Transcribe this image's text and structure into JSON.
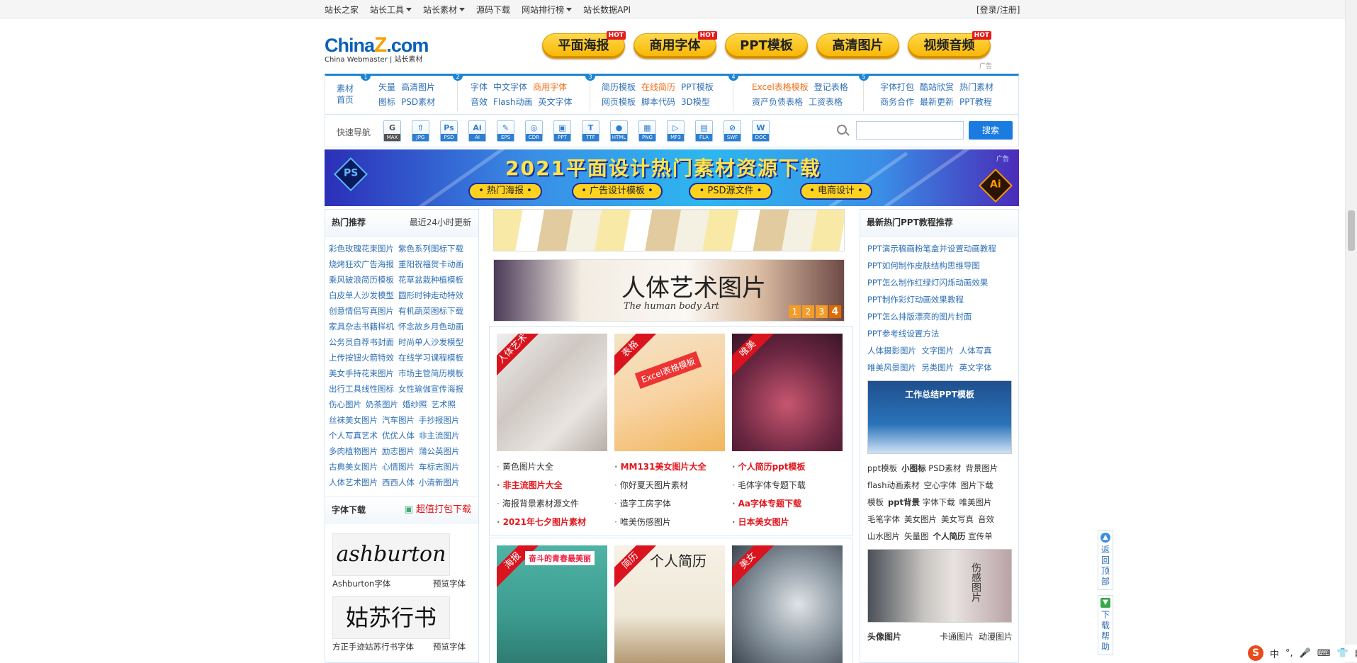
{
  "topnav": {
    "items": [
      "站长之家",
      "站长工具",
      "站长素材",
      "源码下载",
      "网站排行榜",
      "站长数据API"
    ],
    "login": "[登录/注册]"
  },
  "logo": {
    "main": "China",
    "z": "Z",
    "com": ".com",
    "sub": "China Webmaster | 站长素材"
  },
  "bigbuttons": [
    {
      "label": "平面海报",
      "hot": "HOT"
    },
    {
      "label": "商用字体",
      "hot": "HOT"
    },
    {
      "label": "PPT模板",
      "hot": ""
    },
    {
      "label": "高清图片",
      "hot": ""
    },
    {
      "label": "视频音频",
      "hot": "HOT"
    }
  ],
  "ad_label": "广告",
  "menu": {
    "home": [
      "素材",
      "首页"
    ],
    "col1": [
      [
        "矢量",
        "高清图片"
      ],
      [
        "图标",
        "PSD素材"
      ]
    ],
    "col2": [
      [
        "字体",
        "中文字体",
        "商用字体"
      ],
      [
        "音效",
        "Flash动画",
        "英文字体"
      ]
    ],
    "col3": [
      [
        "简历模板",
        "在线简历",
        "PPT模板"
      ],
      [
        "网页模板",
        "脚本代码",
        "3D模型"
      ]
    ],
    "col4": [
      [
        "Excel表格模板",
        "登记表格"
      ],
      [
        "资产负债表格",
        "工资表格"
      ]
    ],
    "col5": [
      [
        "字体打包",
        "酷站欣赏",
        "热门素材"
      ],
      [
        "商务合作",
        "最新更新",
        "PPT教程"
      ]
    ],
    "nums": [
      "1",
      "2",
      "3",
      "4",
      "5"
    ]
  },
  "quick": {
    "label": "快速导航",
    "icons": [
      "MAX",
      "JPG",
      "PSD",
      "AI",
      "EPS",
      "CDR",
      "PPT",
      "TTF",
      "HTML",
      "PNG",
      "MP3",
      "FLA",
      "SWF",
      "DOC"
    ],
    "icon_glyphs": [
      "G",
      "⇧",
      "Ps",
      "Ai",
      "✎",
      "◎",
      "▣",
      "T",
      "●",
      "▦",
      "▷",
      "▤",
      "⊘",
      "W"
    ],
    "search_placeholder": "",
    "search_button": "搜索"
  },
  "banner": {
    "title": "2021平面设计热门素材资源下载",
    "tags": [
      "• 热门海报 •",
      "• 广告设计模板 •",
      "• PSD源文件 •",
      "• 电商设计 •"
    ],
    "ps": "PS",
    "ai": "Ai",
    "ad": "广告"
  },
  "left": {
    "hot_title": "热门推荐",
    "hot_update": "最近24小时更新",
    "hot_rows": [
      [
        "彩色玫瑰花束图片",
        "紫色系列图标下载"
      ],
      [
        "烧烤狂欢广告海报",
        "重阳祝福贺卡动画"
      ],
      [
        "乘风破浪简历模板",
        "花草盆栽种植模板"
      ],
      [
        "白皮单人沙发模型",
        "圆形时钟走动特效"
      ],
      [
        "创意情侣写真图片",
        "有机蔬菜图标下载"
      ],
      [
        "家具杂志书籍样机",
        "怀念故乡月色动画"
      ],
      [
        "公务员自荐书封面",
        "时尚单人沙发模型"
      ],
      [
        "上传按钮火箭特效",
        "在线学习课程模板"
      ],
      [
        "美女手持花束图片",
        "市场主管简历模板"
      ],
      [
        "出行工具线性图标",
        "女性瑜伽宣传海报"
      ],
      [
        "伤心图片",
        "奶茶图片",
        "婚纱照",
        "艺术照"
      ],
      [
        "丝袜美女图片",
        "汽车图片",
        "手抄报图片"
      ],
      [
        "个人写真艺术",
        "优优人体",
        "非主流图片"
      ],
      [
        "多肉植物图片",
        "励志图片",
        "蒲公英图片"
      ],
      [
        "古典美女图片",
        "心情图片",
        "车标志图片"
      ],
      [
        "人体艺术图片",
        "西西人体",
        "小清新图片"
      ]
    ],
    "font_title": "字体下载",
    "font_pack": "超值打包下载",
    "fonts": [
      {
        "sample": "ashburton",
        "name": "Ashburton字体",
        "preview": "预览字体"
      },
      {
        "sample": "姑苏行书",
        "name": "方正手迹姑苏行书字体",
        "preview": "预览字体"
      }
    ]
  },
  "middle": {
    "img2_title": "人体艺术图片",
    "img2_sub": "The human body Art",
    "pager": [
      "1",
      "2",
      "3",
      "4"
    ],
    "grid1": {
      "ribbons": [
        "人体艺术",
        "表格",
        "唯美"
      ],
      "thumb2_text": "Excel表格模板",
      "links": [
        [
          {
            "t": "黄色图片大全",
            "r": false
          },
          {
            "t": "MM131美女图片大全",
            "r": true
          },
          {
            "t": "个人简历ppt模板",
            "r": true
          }
        ],
        [
          {
            "t": "非主流图片大全",
            "r": true
          },
          {
            "t": "你好夏天图片素材",
            "r": false
          },
          {
            "t": "毛体字体专题下载",
            "r": false
          }
        ],
        [
          {
            "t": "海报背景素材源文件",
            "r": false
          },
          {
            "t": "造字工房字体",
            "r": false
          },
          {
            "t": "Aa字体专题下载",
            "r": true
          }
        ],
        [
          {
            "t": "2021年七夕图片素材",
            "r": true
          },
          {
            "t": "唯美伤感图片",
            "r": false
          },
          {
            "t": "日本美女图片",
            "r": true
          }
        ]
      ]
    },
    "grid2": {
      "ribbons": [
        "海报",
        "简历",
        "美女"
      ],
      "thumb1_text": "奋斗的青春最美丽",
      "thumb2_text": "个人简历"
    }
  },
  "right": {
    "ppt_title": "最新热门PPT教程推荐",
    "ppt_items": [
      "PPT演示稿画粉笔盒并设置动画教程",
      "PPT如何制作皮肤结构思维导图",
      "PPT怎么制作红绿灯闪烁动画效果",
      "PPT制作彩灯动画效果教程",
      "PPT怎么排版漂亮的图片封面",
      "PPT参考线设置方法"
    ],
    "ppt_tag_rows": [
      [
        "人体摄影图片",
        "文字图片",
        "人体写真"
      ],
      [
        "唯美风景图片",
        "另类图片",
        "英文字体"
      ]
    ],
    "ppt_banner": "工作总结PPT模板",
    "tags": [
      [
        {
          "t": "ppt模板",
          "b": false
        },
        {
          "t": "小图标",
          "b": true
        },
        {
          "t": "PSD素材",
          "b": false
        },
        {
          "t": "背景图片",
          "b": false
        }
      ],
      [
        {
          "t": "flash动画素材",
          "b": false
        },
        {
          "t": "空心字体",
          "b": false
        },
        {
          "t": "图片下载",
          "b": false
        }
      ],
      [
        {
          "t": "模板",
          "b": false
        },
        {
          "t": "ppt背景",
          "b": true
        },
        {
          "t": "字体下载",
          "b": false
        },
        {
          "t": "唯美图片",
          "b": false
        }
      ],
      [
        {
          "t": "毛笔字体",
          "b": false
        },
        {
          "t": "美女图片",
          "b": false
        },
        {
          "t": "美女写真",
          "b": false
        },
        {
          "t": "音效",
          "b": false
        }
      ],
      [
        {
          "t": "山水图片",
          "b": false
        },
        {
          "t": "矢量图",
          "b": false
        },
        {
          "t": "个人简历",
          "b": true
        },
        {
          "t": "宣传单",
          "b": false
        }
      ]
    ],
    "sad_text": "伤感图片",
    "bottom_title": "头像图片",
    "bottom_r1": "卡通图片",
    "bottom_r2": "动漫图片"
  },
  "side": {
    "top": [
      "返",
      "回",
      "顶",
      "部"
    ],
    "help": [
      "下",
      "载",
      "帮",
      "助"
    ]
  },
  "ime": [
    "S",
    "中",
    "°,",
    "🎤",
    "⌨",
    "👕",
    "▦"
  ]
}
